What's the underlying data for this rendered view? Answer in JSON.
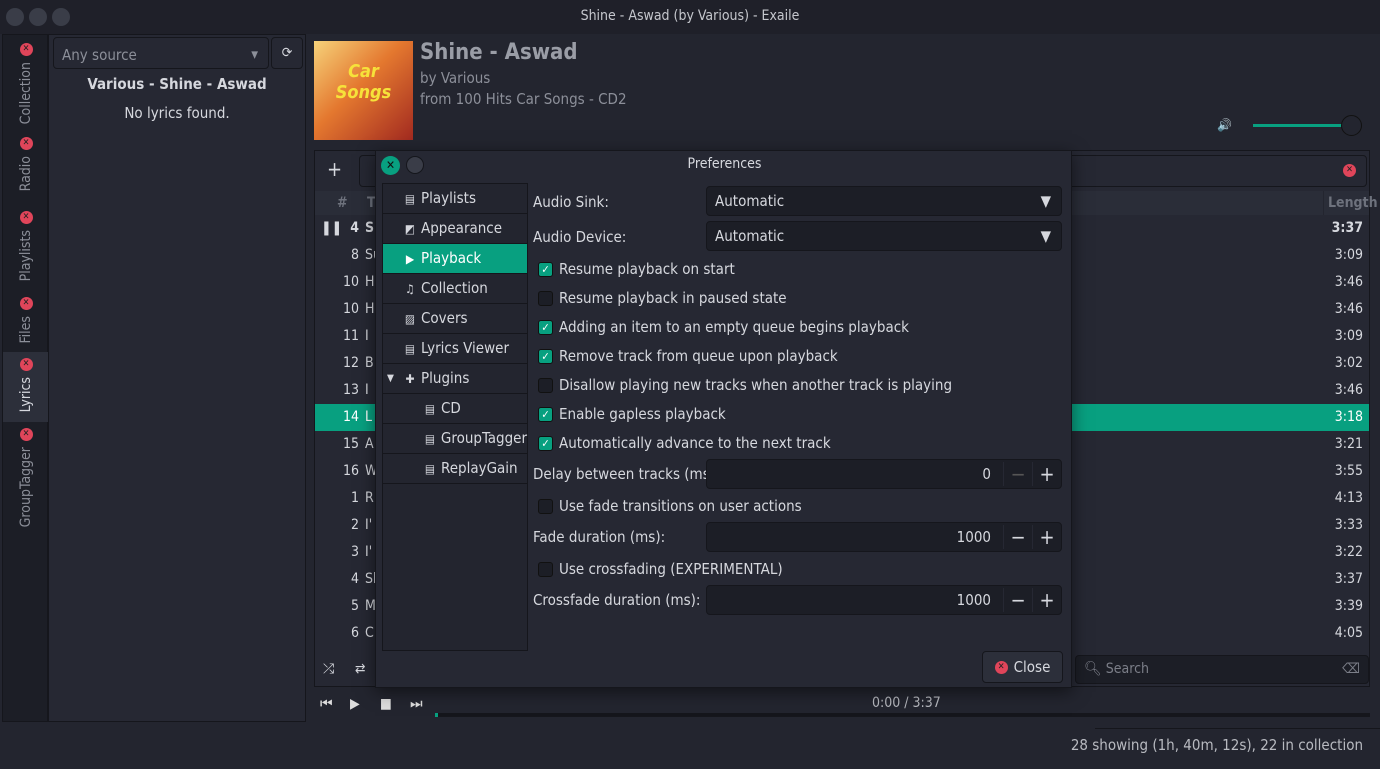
{
  "window": {
    "title": "Shine - Aswad (by Various) - Exaile"
  },
  "side_tabs": [
    {
      "label": "Collection"
    },
    {
      "label": "Radio"
    },
    {
      "label": "Playlists"
    },
    {
      "label": "Files"
    },
    {
      "label": "Lyrics",
      "selected": true
    },
    {
      "label": "GroupTagger"
    }
  ],
  "lyrics": {
    "source": "Any source",
    "heading": "Various - Shine - Aswad",
    "message": "No lyrics found."
  },
  "now_playing": {
    "title": "Shine - Aswad",
    "artist": "by Various",
    "album": "from 100 Hits Car Songs - CD2",
    "cover_text": "100 HITS Car Songs",
    "volume": 0.9
  },
  "playlist": {
    "columns": {
      "num": "#",
      "title": "T",
      "length": "Length"
    },
    "rows": [
      {
        "n": "4",
        "t": "Sh",
        "len": "3:37",
        "playing": true
      },
      {
        "n": "8",
        "t": "Su",
        "len": "3:09"
      },
      {
        "n": "10",
        "t": "H",
        "len": "3:46"
      },
      {
        "n": "10",
        "t": "H",
        "len": "3:46"
      },
      {
        "n": "11",
        "t": "I",
        "len": "3:09"
      },
      {
        "n": "12",
        "t": "B",
        "len": "3:02"
      },
      {
        "n": "13",
        "t": "I",
        "len": "3:46"
      },
      {
        "n": "14",
        "t": "L",
        "len": "3:18",
        "selected": true
      },
      {
        "n": "15",
        "t": "A",
        "len": "3:21"
      },
      {
        "n": "16",
        "t": "W",
        "len": "3:55"
      },
      {
        "n": "1",
        "t": "R",
        "len": "4:13"
      },
      {
        "n": "2",
        "t": "I'",
        "len": "3:33"
      },
      {
        "n": "3",
        "t": "I'",
        "len": "3:22"
      },
      {
        "n": "4",
        "t": "Sh",
        "len": "3:37"
      },
      {
        "n": "5",
        "t": "M",
        "len": "3:39"
      },
      {
        "n": "6",
        "t": "C",
        "len": "4:05"
      }
    ],
    "search_placeholder": "Search"
  },
  "player": {
    "time": "0:00 / 3:37",
    "progress": 0.0
  },
  "status": "28 showing (1h, 40m, 12s), 22 in collection",
  "preferences": {
    "title": "Preferences",
    "nav": [
      {
        "label": "Playlists",
        "icon": "playlist-icon"
      },
      {
        "label": "Appearance",
        "icon": "appearance-icon"
      },
      {
        "label": "Playback",
        "icon": "play-icon",
        "selected": true
      },
      {
        "label": "Collection",
        "icon": "music-note-icon"
      },
      {
        "label": "Covers",
        "icon": "cover-icon"
      },
      {
        "label": "Lyrics Viewer",
        "icon": "plugin-icon"
      },
      {
        "label": "Plugins",
        "icon": "puzzle-icon",
        "expanded": true
      },
      {
        "label": "CD",
        "icon": "plugin-icon",
        "child": true
      },
      {
        "label": "GroupTagger",
        "icon": "plugin-icon",
        "child": true
      },
      {
        "label": "ReplayGain",
        "icon": "plugin-icon",
        "child": true
      }
    ],
    "audio_sink_label": "Audio Sink:",
    "audio_sink": "Automatic",
    "audio_device_label": "Audio Device:",
    "audio_device": "Automatic",
    "options": [
      {
        "label": "Resume playback on start",
        "checked": true
      },
      {
        "label": "Resume playback in paused state",
        "checked": false
      },
      {
        "label": "Adding an item to an empty queue begins playback",
        "checked": true
      },
      {
        "label": "Remove track from queue upon playback",
        "checked": true
      },
      {
        "label": "Disallow playing new tracks when another track is playing",
        "checked": false
      },
      {
        "label": "Enable gapless playback",
        "checked": true
      },
      {
        "label": "Automatically advance to the next track",
        "checked": true
      }
    ],
    "delay_label": "Delay between tracks (ms):",
    "delay": "0",
    "fade_option": {
      "label": "Use fade transitions on user actions",
      "checked": false
    },
    "fade_label": "Fade duration (ms):",
    "fade": "1000",
    "crossfade_option": {
      "label": "Use crossfading (EXPERIMENTAL)",
      "checked": false
    },
    "crossfade_label": "Crossfade duration (ms):",
    "crossfade": "1000",
    "close": "Close"
  },
  "colors": {
    "accent": "#08a080",
    "close": "#e0455a",
    "bg": "#23252f"
  }
}
